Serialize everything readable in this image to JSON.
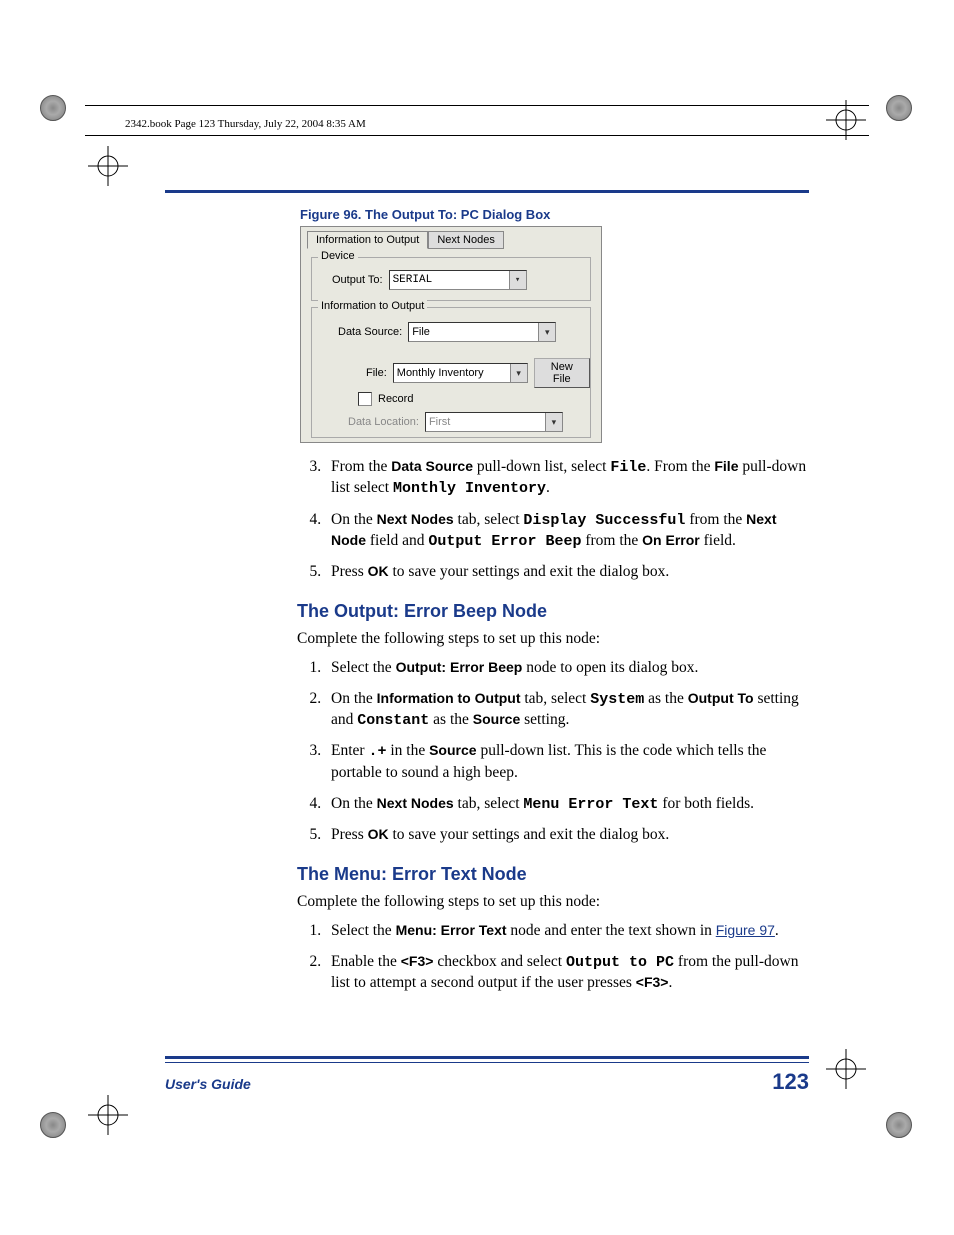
{
  "header": {
    "crop_text": "2342.book  Page 123  Thursday, July 22, 2004  8:35 AM"
  },
  "figure": {
    "caption": "Figure 96. The Output To: PC Dialog Box",
    "tabs": {
      "active": "Information to Output",
      "inactive": "Next Nodes"
    },
    "device": {
      "legend": "Device",
      "output_to_label": "Output To:",
      "output_to_value": "SERIAL"
    },
    "info": {
      "legend": "Information to Output",
      "data_source_label": "Data Source:",
      "data_source_value": "File",
      "file_label": "File:",
      "file_value": "Monthly Inventory",
      "new_file_btn": "New File",
      "record_label": "Record",
      "data_location_label": "Data Location:",
      "data_location_value": "First"
    }
  },
  "list1": {
    "i3": {
      "p1a": "From the ",
      "p1b": "Data Source",
      "p1c": " pull-down list, select ",
      "p1d": "File",
      "p1e": ". From the ",
      "p1f": "File",
      "p1g": " pull-down list select ",
      "p1h": "Monthly Inventory",
      "p1i": "."
    },
    "i4": {
      "a": "On the ",
      "b": "Next Nodes",
      "c": " tab, select ",
      "d": "Display Successful",
      "e": " from the ",
      "f": "Next Node",
      "g": " field and ",
      "h": "Output Error Beep",
      "i": " from the ",
      "j": "On Error",
      "k": " field."
    },
    "i5": {
      "a": "Press ",
      "b": "OK",
      "c": " to save your settings and exit the dialog box."
    }
  },
  "section1": {
    "title": "The Output: Error Beep Node",
    "intro": "Complete the following steps to set up this node:",
    "i1": {
      "a": "Select the ",
      "b": "Output: Error Beep",
      "c": " node to open its dialog box."
    },
    "i2": {
      "a": "On the ",
      "b": "Information to Output",
      "c": " tab, select ",
      "d": "System",
      "e": " as the ",
      "f": "Output To",
      "g": " setting and ",
      "h": "Constant",
      "i": " as the ",
      "j": "Source",
      "k": " setting."
    },
    "i3": {
      "a": "Enter ",
      "b": ".+",
      "c": " in the ",
      "d": "Source",
      "e": " pull-down list. This is the code which tells the portable to sound a high beep."
    },
    "i4": {
      "a": "On the ",
      "b": "Next Nodes",
      "c": " tab, select ",
      "d": "Menu Error Text",
      "e": " for both fields."
    },
    "i5": {
      "a": "Press ",
      "b": "OK",
      "c": " to save your settings and exit the dialog box."
    }
  },
  "section2": {
    "title": "The Menu: Error Text Node",
    "intro": "Complete the following steps to set up this node:",
    "i1": {
      "a": "Select the ",
      "b": "Menu: Error Text",
      "c": " node and enter the text shown in ",
      "d": "Figure 97",
      "e": "."
    },
    "i2": {
      "a": "Enable the ",
      "b": "<F3>",
      "c": " checkbox and select ",
      "d": "Output to PC",
      "e": " from the pull-down list to attempt a second output if the user presses ",
      "f": "<F3>",
      "g": "."
    }
  },
  "footer": {
    "title": "User's Guide",
    "page": "123"
  }
}
